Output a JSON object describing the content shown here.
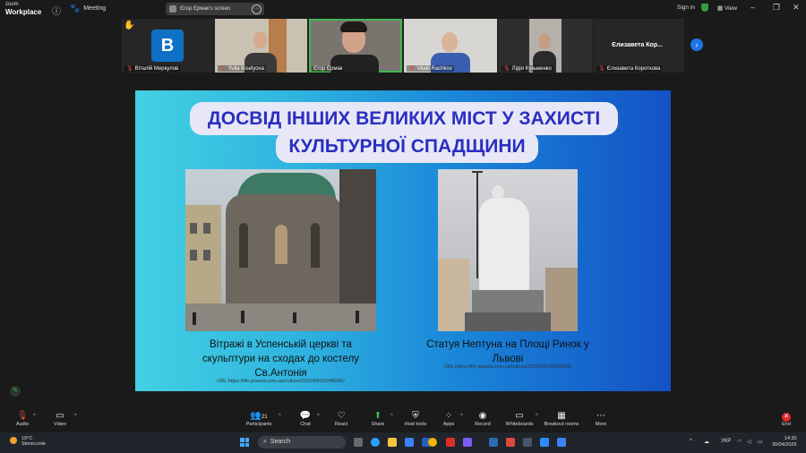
{
  "titlebar": {
    "logo_line1": "zoom",
    "logo_line2": "Workplace",
    "meeting_label": "Meeting",
    "share_pill": "Єгор Єрмак's screen",
    "signin": "Sign in",
    "view": "View",
    "controls": {
      "minimize": "–",
      "restore": "❐",
      "close": "✕"
    }
  },
  "participants": [
    {
      "name": "Віталій Меркулов",
      "avatar_letter": "B",
      "raised_hand": true
    },
    {
      "name": "Yulia Kiselyova"
    },
    {
      "name": "Єгор Єрмак"
    },
    {
      "name": "Vitalii Rachkov"
    },
    {
      "name": "Лідія Кузьменко"
    },
    {
      "name": "Єлизавета Короткова",
      "label": "Єлизавета  Кор..."
    }
  ],
  "slide": {
    "title_line1": "ДОСВІД ІНШИХ ВЕЛИКИХ МІСТ У ЗАХИСТІ",
    "title_line2": "КУЛЬТУРНОЇ СПАДЩИНИ",
    "left_caption": [
      "Вітражі в Успенській церкві та",
      "скульптури на сходах до костелу",
      "Св.Антонія"
    ],
    "left_url": "URL:https://life.pravda.com.ua/culture/2022/04/16/248266/",
    "right_caption": [
      "Статуя Нептуна на Площі Ринок у",
      "Львові"
    ],
    "right_url": "URL:https://life.pravda.com.ua/culture/2022/04/16/248266/"
  },
  "toolbar": {
    "audio": "Audio",
    "video": "Video",
    "participants": "Participants",
    "participants_count": "21",
    "chat": "Chat",
    "react": "React",
    "share": "Share",
    "host_tools": "Host tools",
    "apps": "Apps",
    "record": "Record",
    "whiteboards": "Whiteboards",
    "breakout": "Breakout rooms",
    "more": "More",
    "end": "End"
  },
  "taskbar": {
    "temp": "19°C",
    "weather": "Słonecznie",
    "search_placeholder": "Search",
    "lang": "УКР",
    "time": "14:30",
    "date": "30/04/2025"
  },
  "colors": {
    "accent": "#1e73e8",
    "slide_title": "#2a2fbf",
    "end": "#e02828",
    "active_speaker": "#3fb950"
  }
}
